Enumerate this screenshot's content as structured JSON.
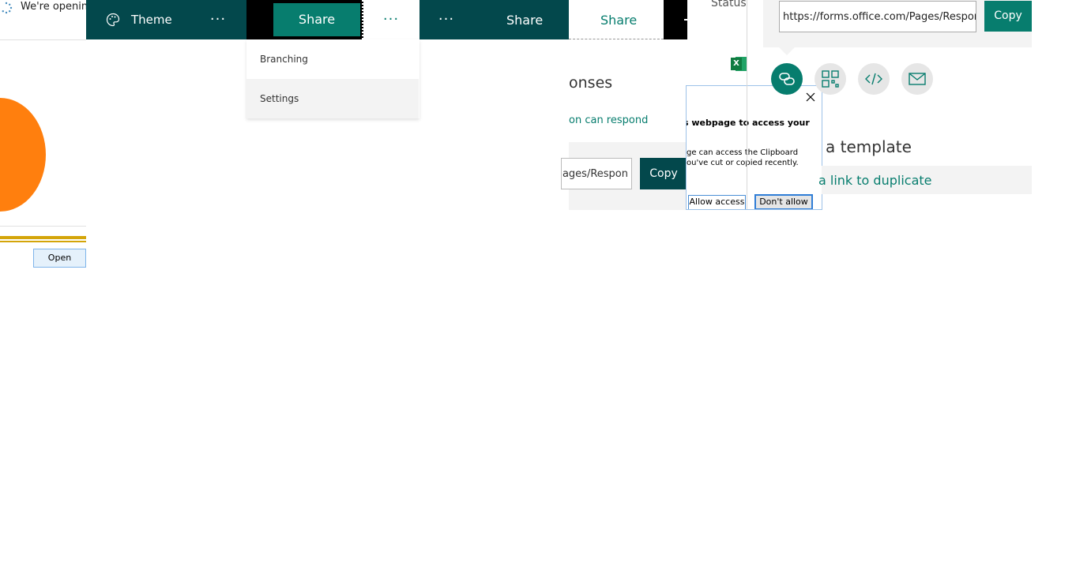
{
  "notification": {
    "opening_text": "We're openin"
  },
  "bar1": {
    "theme_label": "Theme",
    "more_label": "···"
  },
  "bar2": {
    "share_label": "Share",
    "more_label": "···"
  },
  "dropdown": {
    "items": [
      "Branching",
      "Settings"
    ]
  },
  "bar3": {
    "more_label": "···",
    "share_label": "Share"
  },
  "share_tab": {
    "label": "Share"
  },
  "middle_panel": {
    "title_fragment": "onses",
    "respond_fragment": "on can respond",
    "link_fragment": "ages/Respon",
    "copy_label": "Copy"
  },
  "clipboard_dialog": {
    "title_fragment": "s webpage to access your",
    "body_line1": "ge can access the Clipboard",
    "body_line2": "ou've cut or copied recently.",
    "allow_label": "Allow access",
    "deny_label": "Don't allow"
  },
  "status_fragment": "Status",
  "right_panel": {
    "link_value": "https://forms.office.com/Pages/Respon",
    "copy_label": "Copy",
    "template_fragment": "a template",
    "duplicate_fragment": "a link to duplicate"
  },
  "left_panel": {
    "open_label": "Open"
  },
  "colors": {
    "teal_dark": "#03484c",
    "teal_accent": "#077d6e",
    "orange": "#ff7f0e",
    "gold": "#d4a50a"
  }
}
